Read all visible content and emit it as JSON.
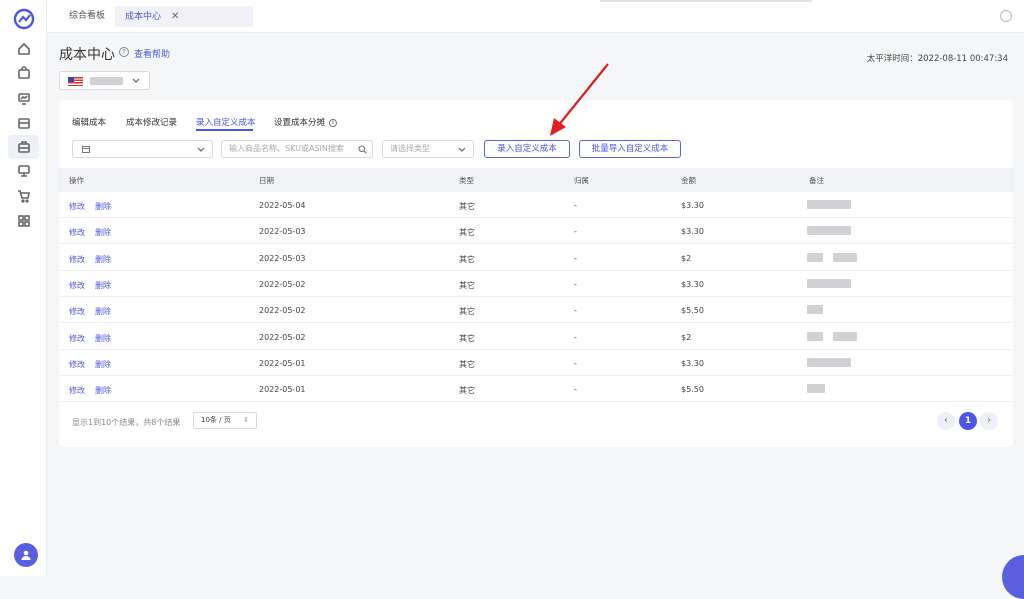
{
  "tabs": [
    {
      "label": "综合看板",
      "active": false
    },
    {
      "label": "成本中心",
      "active": true
    }
  ],
  "header": {
    "title": "成本中心",
    "help_label": "查看帮助",
    "timezone_text": "太平洋时间：2022-08-11 00:47:34"
  },
  "subtabs": [
    "编辑成本",
    "成本修改记录",
    "录入自定义成本",
    "设置成本分摊"
  ],
  "filters": {
    "search_placeholder": "输入商品名称、SKU或ASIN搜索",
    "type_placeholder": "请选择类型"
  },
  "buttons": {
    "add_custom": "录入自定义成本",
    "batch_import": "批量导入自定义成本"
  },
  "table": {
    "columns": [
      "操作",
      "日期",
      "类型",
      "归属",
      "金额",
      "备注"
    ],
    "edit_label": "修改",
    "delete_label": "删除",
    "rows": [
      {
        "date": "2022-05-04",
        "type": "其它",
        "owner": "-",
        "amount": "$3.30"
      },
      {
        "date": "2022-05-03",
        "type": "其它",
        "owner": "-",
        "amount": "$3.30"
      },
      {
        "date": "2022-05-03",
        "type": "其它",
        "owner": "-",
        "amount": "$2"
      },
      {
        "date": "2022-05-02",
        "type": "其它",
        "owner": "-",
        "amount": "$3.30"
      },
      {
        "date": "2022-05-02",
        "type": "其它",
        "owner": "-",
        "amount": "$5.50"
      },
      {
        "date": "2022-05-02",
        "type": "其它",
        "owner": "-",
        "amount": "$2"
      },
      {
        "date": "2022-05-01",
        "type": "其它",
        "owner": "-",
        "amount": "$3.30"
      },
      {
        "date": "2022-05-01",
        "type": "其它",
        "owner": "-",
        "amount": "$5.50"
      }
    ]
  },
  "footer": {
    "summary": "显示1到10个结果，共8个结果",
    "page_size": "10条 / 页",
    "current_page": "1"
  },
  "colors": {
    "accent": "#4b56e8",
    "arrow": "#e02020"
  }
}
